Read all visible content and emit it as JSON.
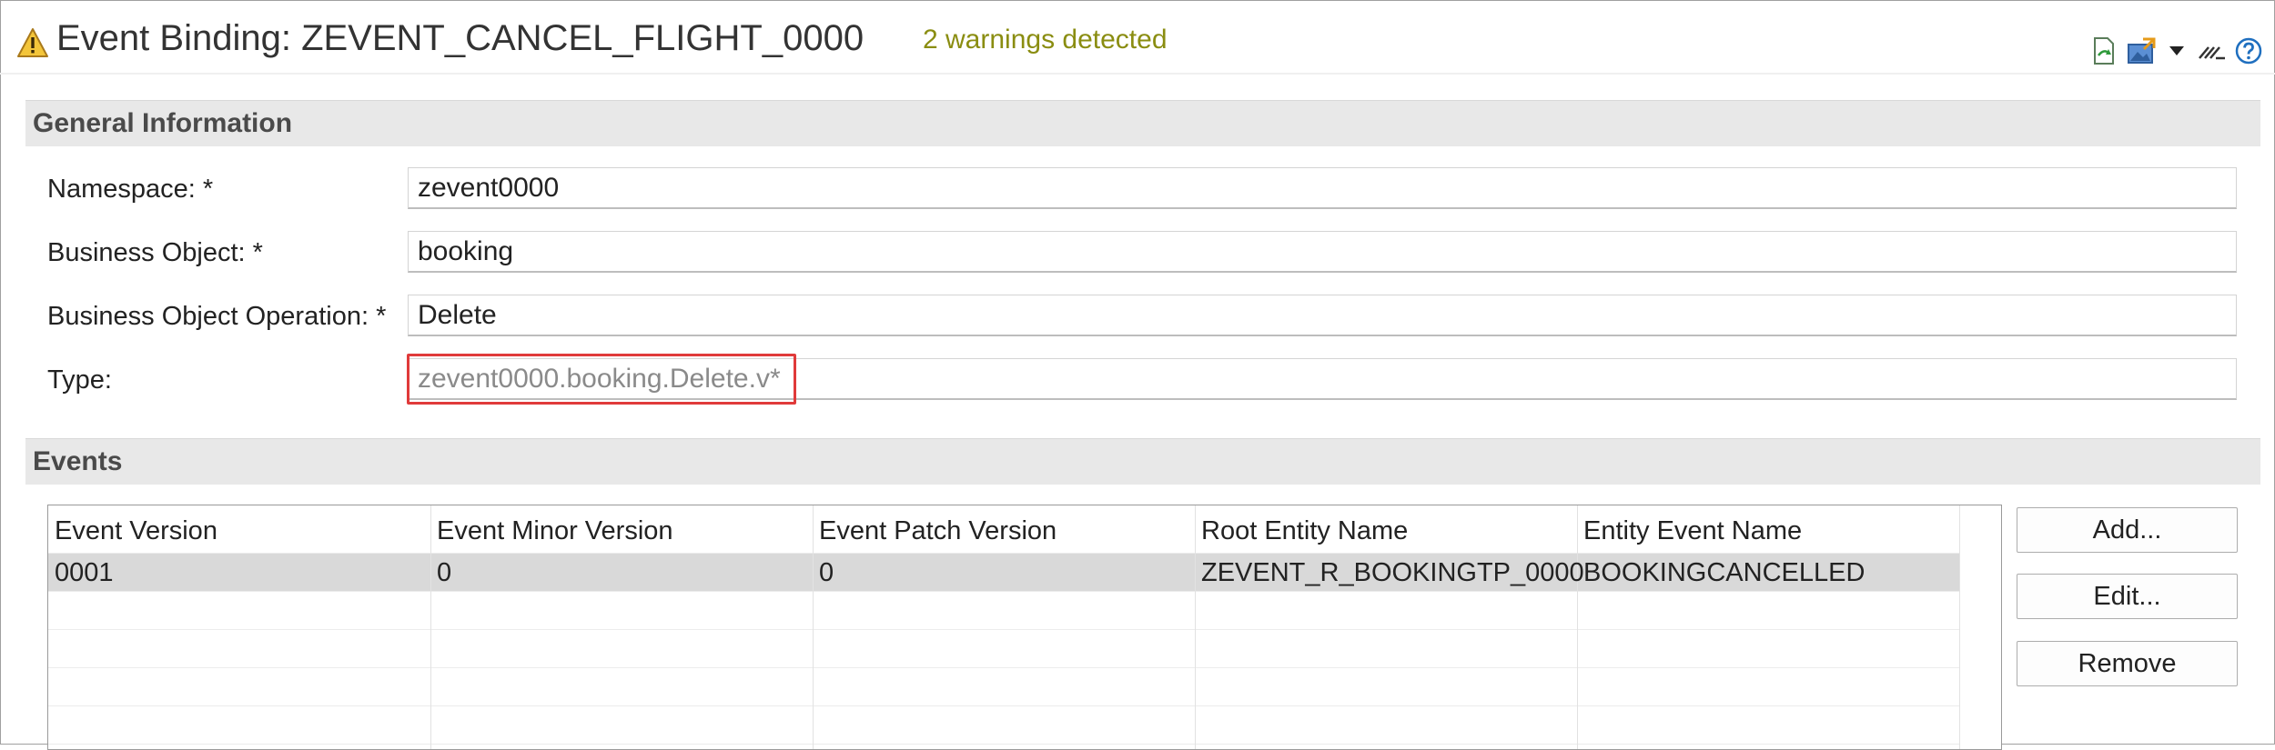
{
  "header": {
    "title": "Event Binding: ZEVENT_CANCEL_FLIGHT_0000",
    "warnings": "2 warnings detected",
    "toolbar_icons": [
      "refresh-document-icon",
      "export-image-icon",
      "dropdown-arrow-icon",
      "collapse-editor-icon",
      "help-icon"
    ]
  },
  "general": {
    "section_title": "General Information",
    "namespace_label": "Namespace: *",
    "namespace_value": "zevent0000",
    "bo_label": "Business Object: *",
    "bo_value": "booking",
    "op_label": "Business Object Operation: *",
    "op_value": "Delete",
    "type_label": "Type:",
    "type_value": "zevent0000.booking.Delete.v*"
  },
  "events": {
    "section_title": "Events",
    "columns": [
      "Event Version",
      "Event Minor Version",
      "Event Patch Version",
      "Root Entity Name",
      "Entity Event Name"
    ],
    "rows": [
      [
        "0001",
        "0",
        "0",
        "ZEVENT_R_BOOKINGTP_0000",
        "BOOKINGCANCELLED"
      ]
    ],
    "buttons": {
      "add": "Add...",
      "edit": "Edit...",
      "remove": "Remove"
    }
  },
  "colors": {
    "warning_text": "#8a8d11",
    "highlight_border": "#e03a3a",
    "section_bg": "#e8e8e8",
    "selected_row": "#d9d9d9"
  }
}
